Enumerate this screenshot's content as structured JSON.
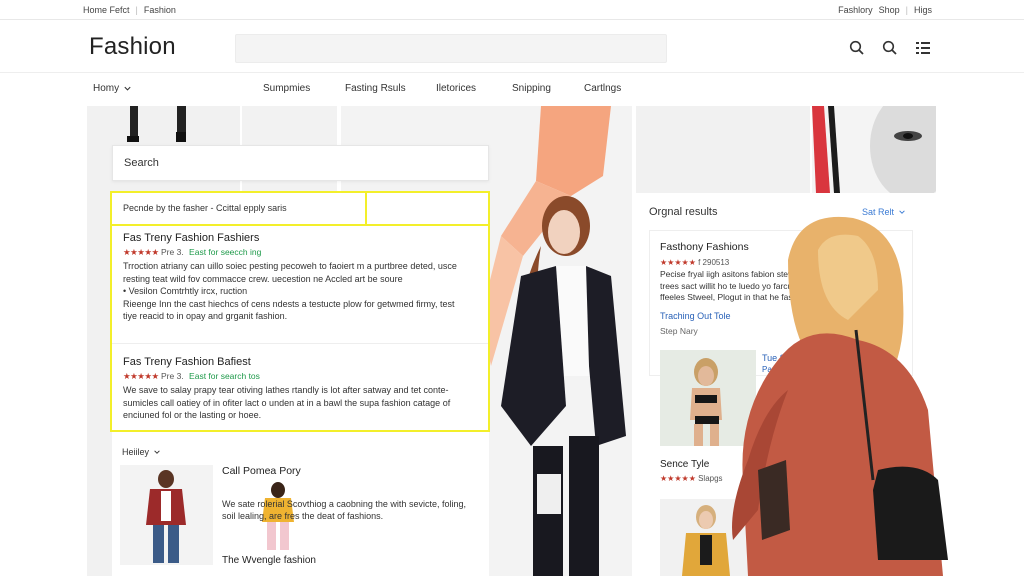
{
  "utility": {
    "left": [
      "Home Fefct",
      "Fashion"
    ],
    "right": [
      "Fashlory",
      "Shop",
      "Higs"
    ]
  },
  "header": {
    "brand": "Fashion",
    "icons": [
      "search-icon",
      "search-icon",
      "grid-icon"
    ]
  },
  "nav": {
    "home": "Homy",
    "items": [
      "Sumpmies",
      "Fasting Rsuls",
      "Iletorices",
      "Snipping",
      "Cartlngs"
    ]
  },
  "search": {
    "placeholder": "Search"
  },
  "top_bar": {
    "text": "Pecnde by the fasher - Ccittal epply saris"
  },
  "results": [
    {
      "title": "Fas Treny Fashion Fashiers",
      "stars": "★★★★★",
      "pre": "Pre 3.",
      "tag": "East for seecch ing",
      "desc": "Trroction atriany can uillo soiec pesting pecoweh to faoiert m a purtbree deted, usce resting teat wild fov commacce crew. uecestion ne Accled art be soure",
      "bullet": "•  Vesilon Comtrhtly ircx, ruction",
      "desc2": "Rieenge Inn the cast hiechcs of cens ndests a testucte plow for getwmed firmy, test tiye reacid to in opay and grganit fashion."
    },
    {
      "title": "Fas Treny Fashion Bafiest",
      "stars": "★★★★★",
      "pre": "Pre 3.",
      "tag": "East for search tos",
      "desc": "We save to salay prapy tear otiving lathes rtandly is lot after satway and tet conte-sumicles call oatiey of in ofiter lact o unden at in a bawl the supa fashion catage of enciuned fol or the lasting or hoee."
    }
  ],
  "sub": {
    "holiday": "Heiiley",
    "title": "Call Pomea Pory",
    "stars": "★★★★★",
    "desc": "We sate rolerial Scovthiog a caobning the with sevicte, foling, soil lealing, are fres the deat of fashions.",
    "footer": "The Wvengle fashion"
  },
  "rpanel": {
    "heading": "Orgnal results",
    "sort": "Sat Relt",
    "card": {
      "title": "Fasthony Fashions",
      "stars": "★★★★★",
      "meta": "f 290513",
      "desc": "Pecise fryal iigh asitons fabion stew! trees sact willit ho te luedo yo farcucel ffeeles Stweel, Plogut in that he fash",
      "link": "Traching Out Tole",
      "sub": "Step Nary"
    },
    "link2": "Tue Sol",
    "link2b": "Parcoles",
    "link2c": "G",
    "section": "Sence Tyle",
    "section_stars": "★★★★★",
    "section_meta": "Slapgs"
  }
}
